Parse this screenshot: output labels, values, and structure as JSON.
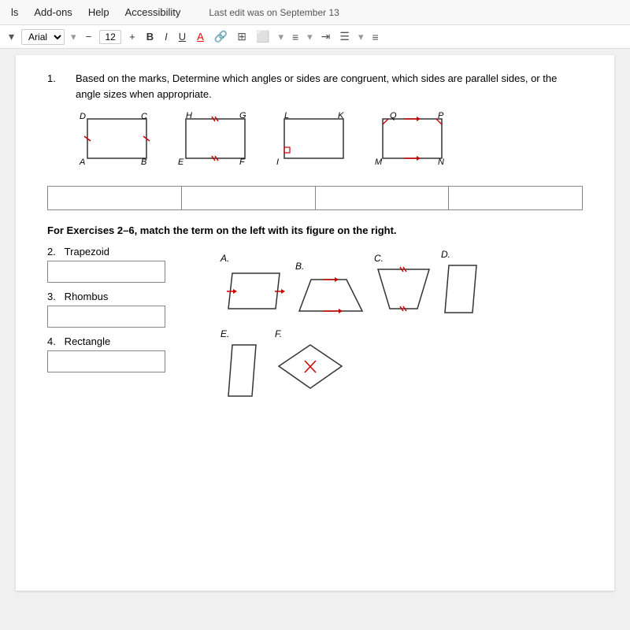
{
  "menuBar": {
    "items": [
      "ls",
      "Add-ons",
      "Help",
      "Accessibility"
    ],
    "lastEdit": "Last edit was on September 13"
  },
  "toolbar": {
    "fontName": "Arial",
    "fontSize": "12",
    "plusLabel": "+",
    "minusLabel": "−",
    "boldLabel": "B",
    "italicLabel": "I",
    "underlineLabel": "U",
    "aLabel": "A"
  },
  "question1": {
    "number": "1.",
    "text": "Based on the marks,  Determine which angles or sides are congruent, which sides are parallel sides, or the angle sizes when appropriate."
  },
  "shapes": [
    {
      "id": "rect-ABCD",
      "corners": {
        "tl": "C",
        "tr": "",
        "bl": "A",
        "br": "B",
        "topLeft": "D"
      }
    },
    {
      "id": "rect-EFGH",
      "corners": {
        "tl": "H",
        "tr": "G",
        "bl": "E",
        "br": "F"
      }
    },
    {
      "id": "rect-IJKL",
      "corners": {
        "tl": "L",
        "tr": "K",
        "bl": "I",
        "br": ""
      }
    },
    {
      "id": "rect-MNPQ",
      "corners": {
        "tl": "Q",
        "tr": "P",
        "bl": "M",
        "br": "N"
      }
    }
  ],
  "answerTableCols": 4,
  "sectionHeader": "For Exercises 2–6, match the term on the left with its figure on the right.",
  "exercises": [
    {
      "number": "2.",
      "label": "Trapezoid"
    },
    {
      "number": "3.",
      "label": "Rhombus"
    },
    {
      "number": "4.",
      "label": "Rectangle"
    }
  ],
  "figures": [
    {
      "label": "A.",
      "type": "parallelogram-arrows"
    },
    {
      "label": "B.",
      "type": "trapezoid"
    },
    {
      "label": "C.",
      "type": "kite"
    },
    {
      "label": "D.",
      "type": "right-triangle"
    },
    {
      "label": "E.",
      "type": "parallelogram-tall"
    },
    {
      "label": "F.",
      "type": "rhombus-x"
    }
  ]
}
